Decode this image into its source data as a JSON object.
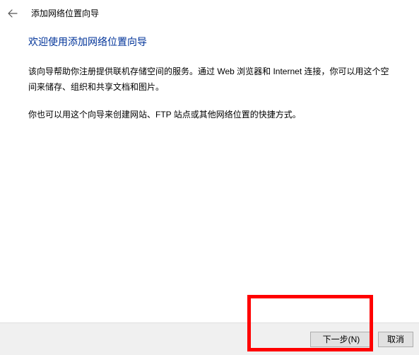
{
  "header": {
    "title": "添加网络位置向导"
  },
  "content": {
    "welcome_title": "欢迎使用添加网络位置向导",
    "paragraph1": "该向导帮助你注册提供联机存储空间的服务。通过 Web 浏览器和 Internet 连接，你可以用这个空间来储存、组织和共享文档和图片。",
    "paragraph2": "你也可以用这个向导来创建网站、FTP 站点或其他网络位置的快捷方式。"
  },
  "footer": {
    "next_label": "下一步(N)",
    "cancel_label": "取消"
  }
}
